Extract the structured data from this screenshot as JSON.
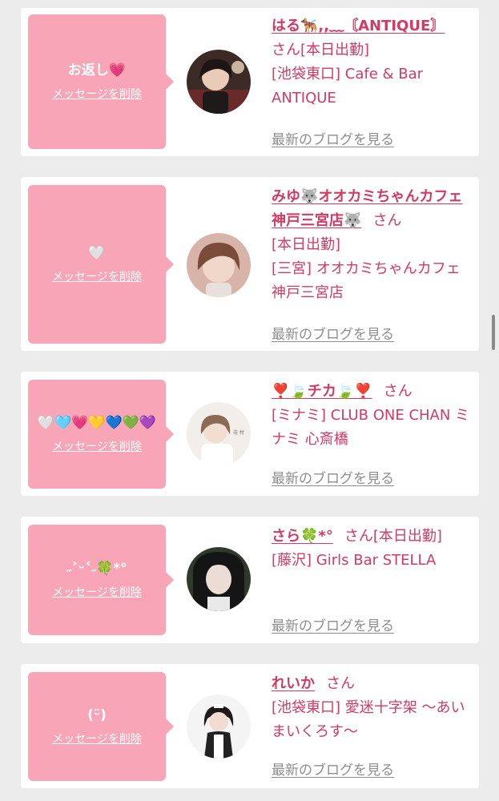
{
  "items": [
    {
      "message": "お返し💗",
      "delete_label": "メッセージを削除",
      "name": "はる🐕‍🦺,,﹏〘ANTIQUE〙",
      "san": "さん[本日出勤]",
      "store": "[池袋東口] Cafe & Bar ANTIQUE",
      "blog_label": "最新のブログを見る",
      "avatar_icon": "profile-photo-haru"
    },
    {
      "message": "🤍",
      "delete_label": "メッセージを削除",
      "name": "みゆ🐺オオカミちゃんカフェ神戸三宮店🐺",
      "san": "さん",
      "status": "[本日出勤]",
      "store": "[三宮] オオカミちゃんカフェ神戸三宮店",
      "blog_label": "最新のブログを見る",
      "avatar_icon": "profile-photo-miyu"
    },
    {
      "message": "🤍🩵💗💛💙💚💜",
      "delete_label": "メッセージを削除",
      "name": "❣️🍃チカ🍃❣️",
      "san": "さん",
      "store": "[ミナミ] CLUB ONE CHAN ミナミ 心斎橋",
      "blog_label": "最新のブログを見る",
      "avatar_icon": "profile-photo-chika"
    },
    {
      "message": "˶˃ᵕ˂˶🍀*°",
      "delete_label": "メッセージを削除",
      "name": "さら🍀*°",
      "san": "さん[本日出勤]",
      "store": "[藤沢] Girls Bar STELLA",
      "blog_label": "最新のブログを見る",
      "avatar_icon": "profile-photo-sara"
    },
    {
      "message": "(ᵕ̈)",
      "delete_label": "メッセージを削除",
      "name": "れいか",
      "san": "さん",
      "store": "[池袋東口] 愛迷十字架 〜あいまいくろす〜",
      "blog_label": "最新のブログを見る",
      "avatar_icon": "profile-photo-reika"
    }
  ]
}
